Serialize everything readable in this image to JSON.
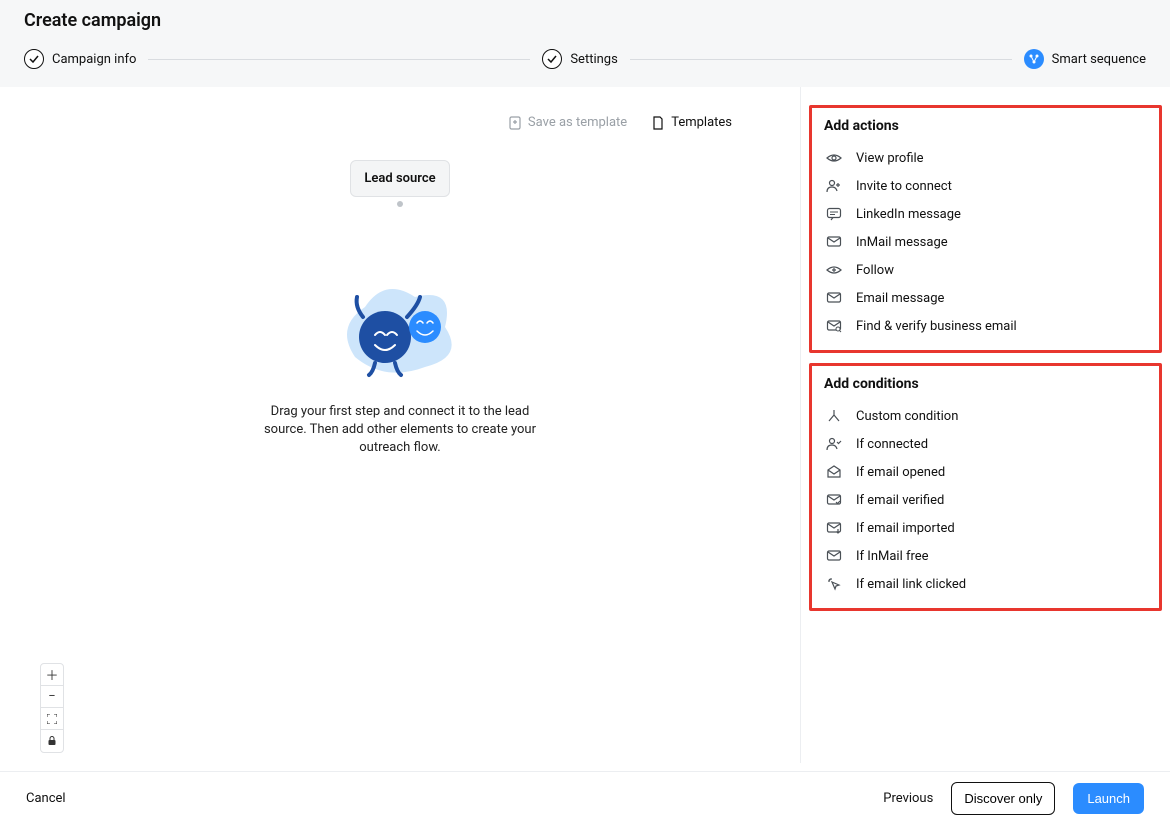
{
  "page_title": "Create campaign",
  "stepper": {
    "step1": "Campaign info",
    "step2": "Settings",
    "step3": "Smart sequence"
  },
  "templates": {
    "save": "Save as template",
    "list": "Templates"
  },
  "canvas": {
    "node_label": "Lead source",
    "empty_text": "Drag your first step and connect it to the lead source. Then add other elements to create your outreach flow."
  },
  "sidebar": {
    "actions_title": "Add actions",
    "conditions_title": "Add conditions",
    "actions": {
      "view_profile": "View profile",
      "invite": "Invite to connect",
      "linkedin_msg": "LinkedIn message",
      "inmail": "InMail message",
      "follow": "Follow",
      "email_msg": "Email message",
      "find_verify": "Find & verify business email"
    },
    "conditions": {
      "custom": "Custom condition",
      "connected": "If connected",
      "email_opened": "If email opened",
      "email_verified": "If email verified",
      "email_imported": "If email imported",
      "inmail_free": "If InMail free",
      "link_clicked": "If email link clicked"
    }
  },
  "footer": {
    "cancel": "Cancel",
    "previous": "Previous",
    "discover": "Discover only",
    "launch": "Launch"
  }
}
